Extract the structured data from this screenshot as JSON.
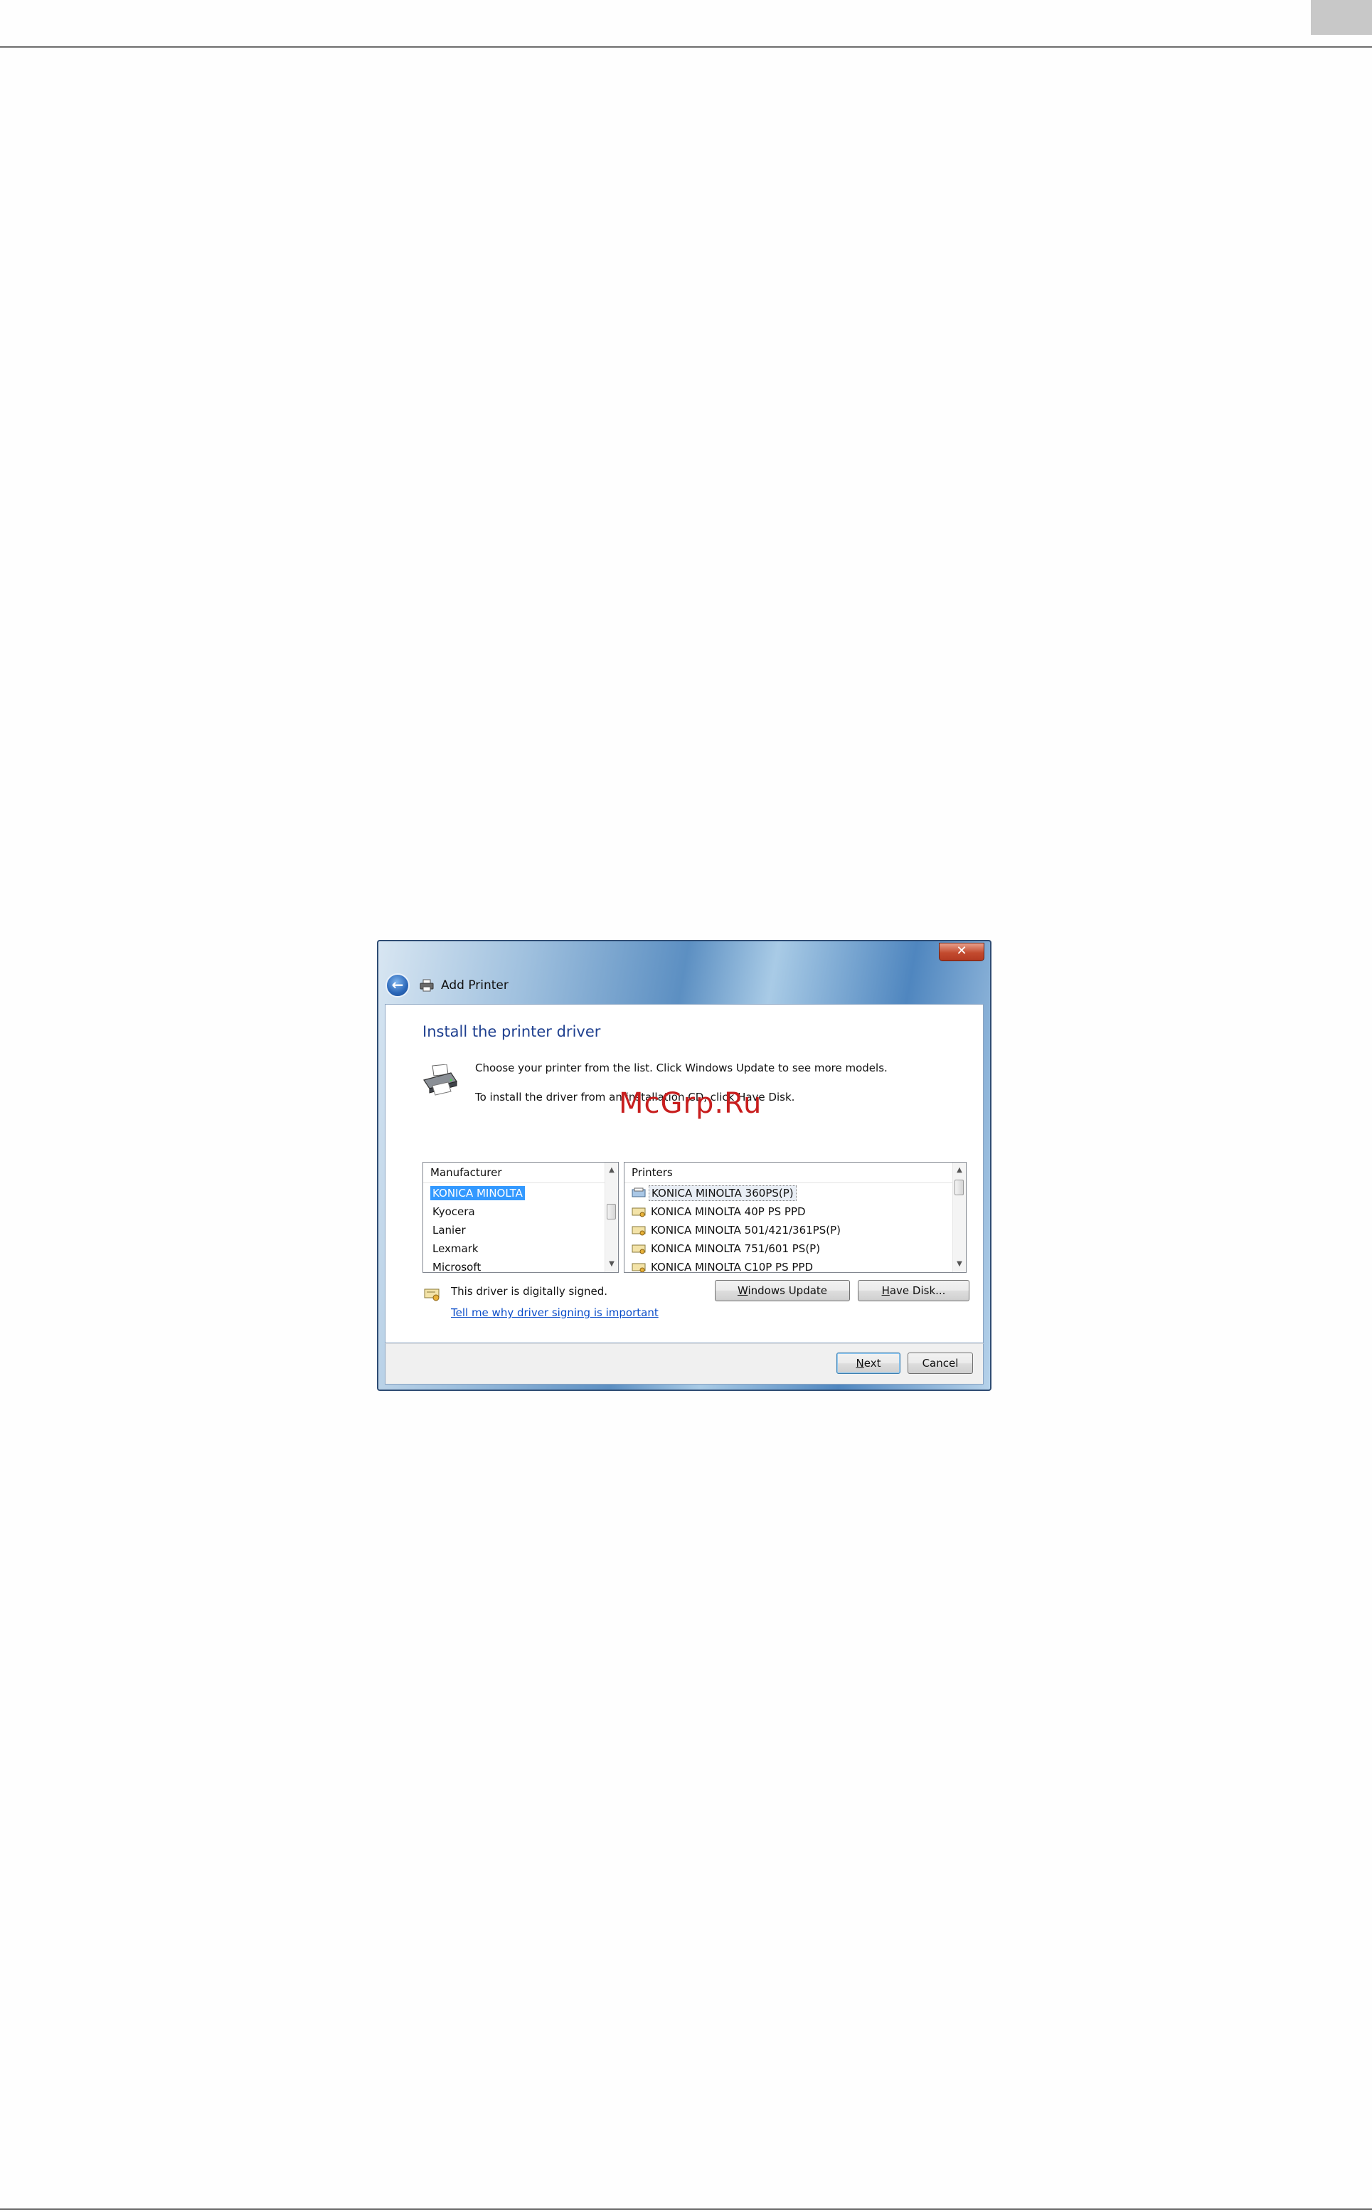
{
  "watermark": "McGrp.Ru",
  "window": {
    "title": "Add Printer",
    "close_glyph": "✕",
    "back_glyph": "←"
  },
  "content": {
    "heading": "Install the printer driver",
    "description_line1": "Choose your printer from the list. Click Windows Update to see more models.",
    "description_line2": "To install the driver from an installation CD, click Have Disk."
  },
  "manufacturer_list": {
    "header": "Manufacturer",
    "items": [
      "KONICA MINOLTA",
      "Kyocera",
      "Lanier",
      "Lexmark",
      "Microsoft"
    ],
    "selected": "KONICA MINOLTA"
  },
  "printers_list": {
    "header": "Printers",
    "items": [
      "KONICA MINOLTA 360PS(P)",
      "KONICA MINOLTA 40P PS PPD",
      "KONICA MINOLTA 501/421/361PS(P)",
      "KONICA MINOLTA 751/601 PS(P)",
      "KONICA MINOLTA C10P PS PPD"
    ],
    "selected": "KONICA MINOLTA 360PS(P)"
  },
  "signing": {
    "status": "This driver is digitally signed.",
    "link": "Tell me why driver signing is important"
  },
  "buttons": {
    "windows_update": "Windows Update",
    "have_disk": "Have Disk...",
    "next": "Next",
    "cancel": "Cancel"
  },
  "colors": {
    "heading": "#1e3f8f",
    "selection": "#3399ff",
    "link": "#0a4cc8",
    "watermark": "#c81e1e"
  }
}
